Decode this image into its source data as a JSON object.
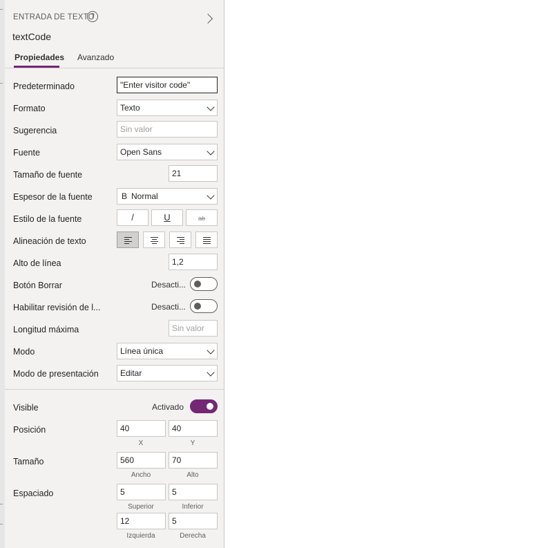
{
  "header": {
    "control_type": "ENTRADA DE TEXTO",
    "help_icon": "?",
    "control_name": "textCode"
  },
  "tabs": [
    {
      "label": "Propiedades",
      "active": true
    },
    {
      "label": "Avanzado",
      "active": false
    }
  ],
  "properties": {
    "default": {
      "label": "Predeterminado",
      "value": "\"Enter visitor code\""
    },
    "format": {
      "label": "Formato",
      "value": "Texto"
    },
    "hint": {
      "label": "Sugerencia",
      "placeholder": "Sin valor"
    },
    "font": {
      "label": "Fuente",
      "value": "Open Sans"
    },
    "font_size": {
      "label": "Tamaño de fuente",
      "value": "21"
    },
    "font_weight": {
      "label": "Espesor de la fuente",
      "glyph": "B",
      "value": "Normal"
    },
    "font_style": {
      "label": "Estilo de la fuente",
      "italic": "/",
      "underline": "U",
      "strikethrough": "ab"
    },
    "text_align": {
      "label": "Alineación de texto",
      "selected": "left"
    },
    "line_height": {
      "label": "Alto de línea",
      "value": "1,2"
    },
    "clear_button": {
      "label": "Botón Borrar",
      "state": "Desacti...",
      "on": false
    },
    "spellcheck": {
      "label": "Habilitar revisión de l...",
      "state": "Desacti...",
      "on": false
    },
    "max_length": {
      "label": "Longitud máxima",
      "placeholder": "Sin valor"
    },
    "mode": {
      "label": "Modo",
      "value": "Línea única"
    },
    "display_mode": {
      "label": "Modo de presentación",
      "value": "Editar"
    }
  },
  "layout_section": {
    "visible": {
      "label": "Visible",
      "state": "Activado",
      "on": true
    },
    "position": {
      "label": "Posición",
      "x": "40",
      "y": "40",
      "x_caption": "X",
      "y_caption": "Y"
    },
    "size": {
      "label": "Tamaño",
      "width": "560",
      "height": "70",
      "width_caption": "Ancho",
      "height_caption": "Alto"
    },
    "padding": {
      "label": "Espaciado",
      "top": "5",
      "bottom": "5",
      "left": "12",
      "right": "5",
      "top_caption": "Superior",
      "bottom_caption": "Inferior",
      "left_caption": "Izquierda",
      "right_caption": "Derecha"
    }
  },
  "colors": {
    "accent": "#742774",
    "panel_bg": "#f3f2f1"
  },
  "icons": [
    "help-icon",
    "chevron-right-icon",
    "chevron-down-icon",
    "bold-icon",
    "italic-icon",
    "underline-icon",
    "strikethrough-icon",
    "align-left-icon",
    "align-center-icon",
    "align-right-icon",
    "align-justify-icon",
    "toggle-switch"
  ]
}
